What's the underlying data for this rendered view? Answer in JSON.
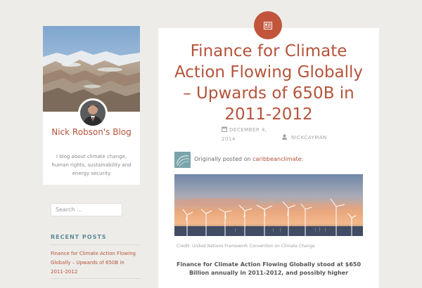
{
  "site": {
    "title": "Nick Robson's Blog",
    "description": "I blog about climate change, human rights, sustainability and energy security"
  },
  "search": {
    "placeholder": "Search …"
  },
  "recent_posts": {
    "title": "RECENT POSTS",
    "items": [
      {
        "label": "Finance for Climate Action Flowing Globally – Upwards of 650B in 2011-2012"
      }
    ]
  },
  "post": {
    "format_icon": "post-format-icon",
    "title": "Finance for Climate Action Flowing Globally – Upwards of 650B in 2011-2012",
    "date": "DECEMBER 4, 2014",
    "author": "NICKCAYMAN",
    "reblog": {
      "prefix": "Originally posted on ",
      "source": "caribbeanclimate",
      "suffix": ":"
    },
    "image_caption": "Credit: United Nations Framework Convention on Climate Change",
    "excerpt": "Finance for Climate Action Flowing Globally stood at $650 Billion annually in 2011-2012, and possibly higher"
  },
  "colors": {
    "accent": "#b5533a",
    "badge": "#c1553b",
    "widget_title": "#5c8a95",
    "background": "#eeece8"
  }
}
